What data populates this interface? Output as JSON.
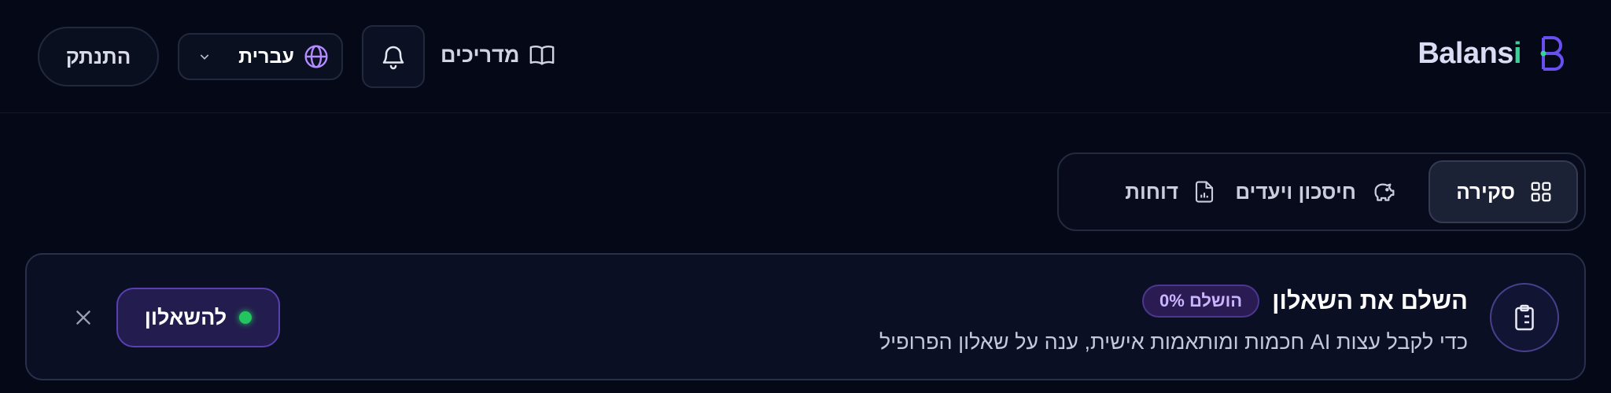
{
  "brand": {
    "name_main": "Balans",
    "name_accent": "i",
    "accent_color": "#37d399",
    "mark_color": "#6a4ff0"
  },
  "header": {
    "logout_label": "התנתק",
    "language": {
      "selected": "עברית",
      "icon": "globe-icon"
    },
    "notifications_icon": "bell-icon",
    "guides_label": "מדריכים",
    "guides_icon": "book-open-icon"
  },
  "tabs": [
    {
      "label": "סקירה",
      "icon": "grid-icon",
      "active": true
    },
    {
      "label": "חיסכון ויעדים",
      "icon": "piggy-bank-icon",
      "active": false
    },
    {
      "label": "דוחות",
      "icon": "report-icon",
      "active": false
    }
  ],
  "banner": {
    "title": "השלם את השאלון",
    "badge": "הושלם 0%",
    "subtitle": "כדי לקבל עצות AI חכמות ומותאמות אישית, ענה על שאלון הפרופיל",
    "cta_label": "להשאלון",
    "icon": "clipboard-icon",
    "close_icon": "close-icon"
  }
}
